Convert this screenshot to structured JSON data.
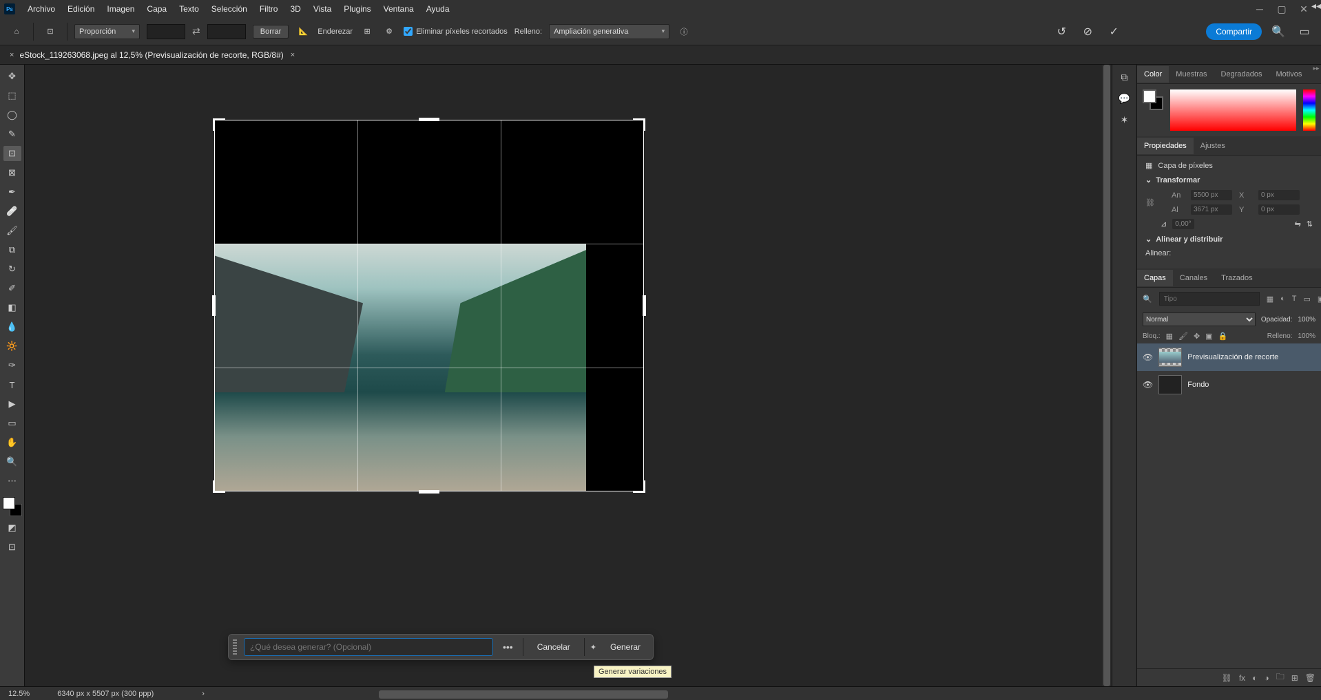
{
  "menu": [
    "Archivo",
    "Edición",
    "Imagen",
    "Capa",
    "Texto",
    "Selección",
    "Filtro",
    "3D",
    "Vista",
    "Plugins",
    "Ventana",
    "Ayuda"
  ],
  "options": {
    "ratio_label": "Proporción",
    "clear": "Borrar",
    "straighten": "Enderezar",
    "delete_cropped": "Eliminar píxeles recortados",
    "fill_label": "Relleno:",
    "fill_value": "Ampliación generativa",
    "share": "Compartir"
  },
  "tab": {
    "title": "eStock_119263068.jpeg al 12,5% (Previsualización de recorte, RGB/8#)"
  },
  "taskbar": {
    "placeholder": "¿Qué desea generar? (Opcional)",
    "cancel": "Cancelar",
    "generate": "Generar",
    "tooltip": "Generar variaciones"
  },
  "panels": {
    "color_tabs": [
      "Color",
      "Muestras",
      "Degradados",
      "Motivos"
    ],
    "props_tabs": [
      "Propiedades",
      "Ajustes"
    ],
    "layer_tabs": [
      "Capas",
      "Canales",
      "Trazados"
    ],
    "pixel_layer": "Capa de píxeles",
    "transform": "Transformar",
    "align": "Alinear y distribuir",
    "align_label": "Alinear:",
    "xform": {
      "an_l": "An",
      "an": "5500 px",
      "al_l": "Al",
      "al": "3671 px",
      "x_l": "X",
      "x": "0 px",
      "y_l": "Y",
      "y": "0 px",
      "angle": "0,00°"
    },
    "filter_placeholder": "Tipo",
    "blend_mode": "Normal",
    "opacity_label": "Opacidad:",
    "opacity": "100%",
    "lock_label": "Bloq.:",
    "fill_label": "Relleno:",
    "fill": "100%",
    "layers": [
      {
        "name": "Previsualización de recorte"
      },
      {
        "name": "Fondo"
      }
    ]
  },
  "status": {
    "zoom": "12.5%",
    "dims": "6340 px x 5507 px (300 ppp)"
  }
}
